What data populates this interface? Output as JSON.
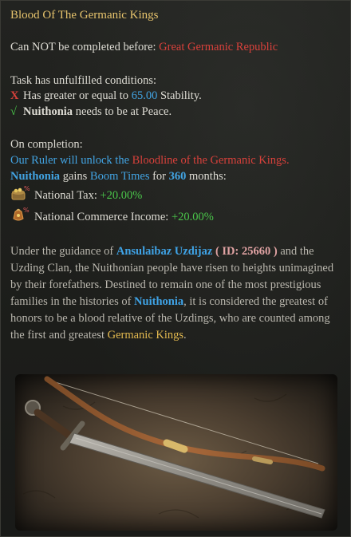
{
  "tooltip": {
    "title": "Blood Of The Germanic Kings",
    "prereq_prefix": "Can NOT be completed before: ",
    "prereq_target": "Great Germanic Republic",
    "conditions_header": "Task has unfulfilled conditions:",
    "conditions": [
      {
        "mark": "X",
        "text_before": "Has greater or equal to ",
        "value": "65.00",
        "text_after": " Stability."
      },
      {
        "mark": "√",
        "subject": "Nuithonia",
        "text_after": " needs to be at Peace."
      }
    ],
    "completion_header": "On completion:",
    "completion_line1": {
      "who": "Our Ruler will unlock the ",
      "what": "Bloodline of the Germanic Kings",
      "end": "."
    },
    "completion_line2": {
      "subject": "Nuithonia",
      "mid": " gains ",
      "modifier": "Boom Times",
      "for": " for ",
      "months": "360",
      "end": " months:"
    },
    "modifiers": [
      {
        "icon": "national-tax-icon",
        "label": "National Tax: ",
        "value": "+20.00%"
      },
      {
        "icon": "commerce-income-icon",
        "label": "National Commerce Income: ",
        "value": "+20.00%"
      }
    ],
    "description": {
      "p1": "Under the guidance of ",
      "ruler": "Ansulaibaz Uzdijaz",
      "id": "( ID: 25660 )",
      "p2": " and the Uzding Clan, the Nuithonian people have risen to heights unimagined by their forefathers. Destined to remain one of the most prestigious families in the histories of ",
      "country": "Nuithonia",
      "p3": ", it is considered the greatest of honors to be a blood relative of the Uzdings, who are counted among the first and greatest ",
      "gk": "Germanic Kings",
      "p4": "."
    },
    "image_icon": "bow-and-sword-illustration"
  },
  "colors": {
    "gold": "#e6c36c",
    "red": "#d8413b",
    "blue": "#42a4e3",
    "green": "#4ac64a",
    "text": "#dedcd4"
  }
}
